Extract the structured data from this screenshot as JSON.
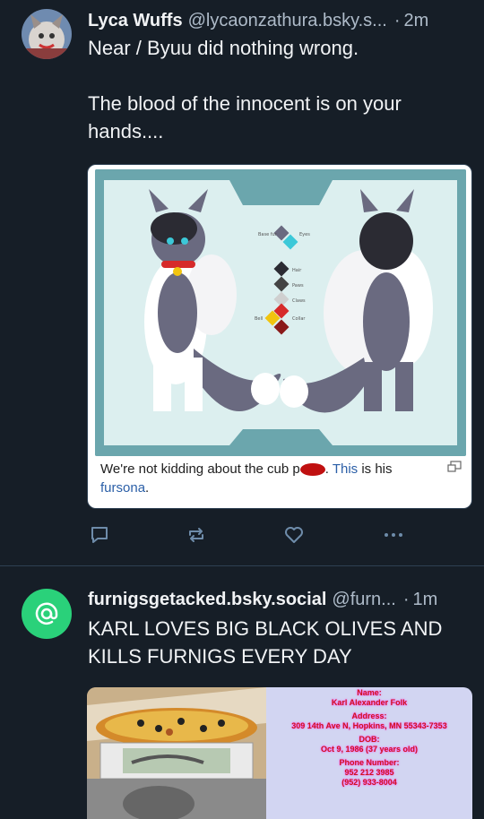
{
  "post1": {
    "display_name": "Lyca Wuffs",
    "handle": "@lycaonzathura.bsky.s...",
    "separator": "·",
    "time": "2m",
    "text_lines": [
      "Near / Byuu did nothing wrong.",
      "",
      "The blood of the innocent is on your",
      "hands...."
    ],
    "embed": {
      "palette_labels": [
        "Base fur",
        "Eyes",
        "Hair",
        "Paws",
        "Claws",
        "Bell",
        "Collar"
      ],
      "caption_before": "We're not kidding about the cub p",
      "caption_after": ". ",
      "caption_link1": "This",
      "caption_mid": " is his ",
      "caption_link2": "fursona",
      "caption_end": "."
    },
    "actions": [
      "reply-icon",
      "repost-icon",
      "like-icon",
      "more-icon"
    ]
  },
  "post2": {
    "display_name": "furnigsgetacked.bsky.social",
    "handle": "@furn...",
    "separator": "·",
    "time": "1m",
    "text_lines": [
      "KARL LOVES BIG BLACK OLIVES AND",
      "KILLS FURNIGS EVERY DAY"
    ],
    "dox": {
      "name_label": "Name:",
      "name": "Karl Alexander Folk",
      "address_label": "Address:",
      "address": "309 14th Ave N, Hopkins, MN 55343-7353",
      "dob_label": "DOB:",
      "dob": "Oct 9, 1986 (37 years old)",
      "phone_label": "Phone Number:",
      "phone1": "952 212 3985",
      "phone2": "(952) 933-8004"
    }
  },
  "colors": {
    "bg": "#161e27",
    "divider": "#2e4052",
    "muted": "#aebbc9",
    "link": "#2b5fa7",
    "avatar_green": "#2ad17a"
  }
}
